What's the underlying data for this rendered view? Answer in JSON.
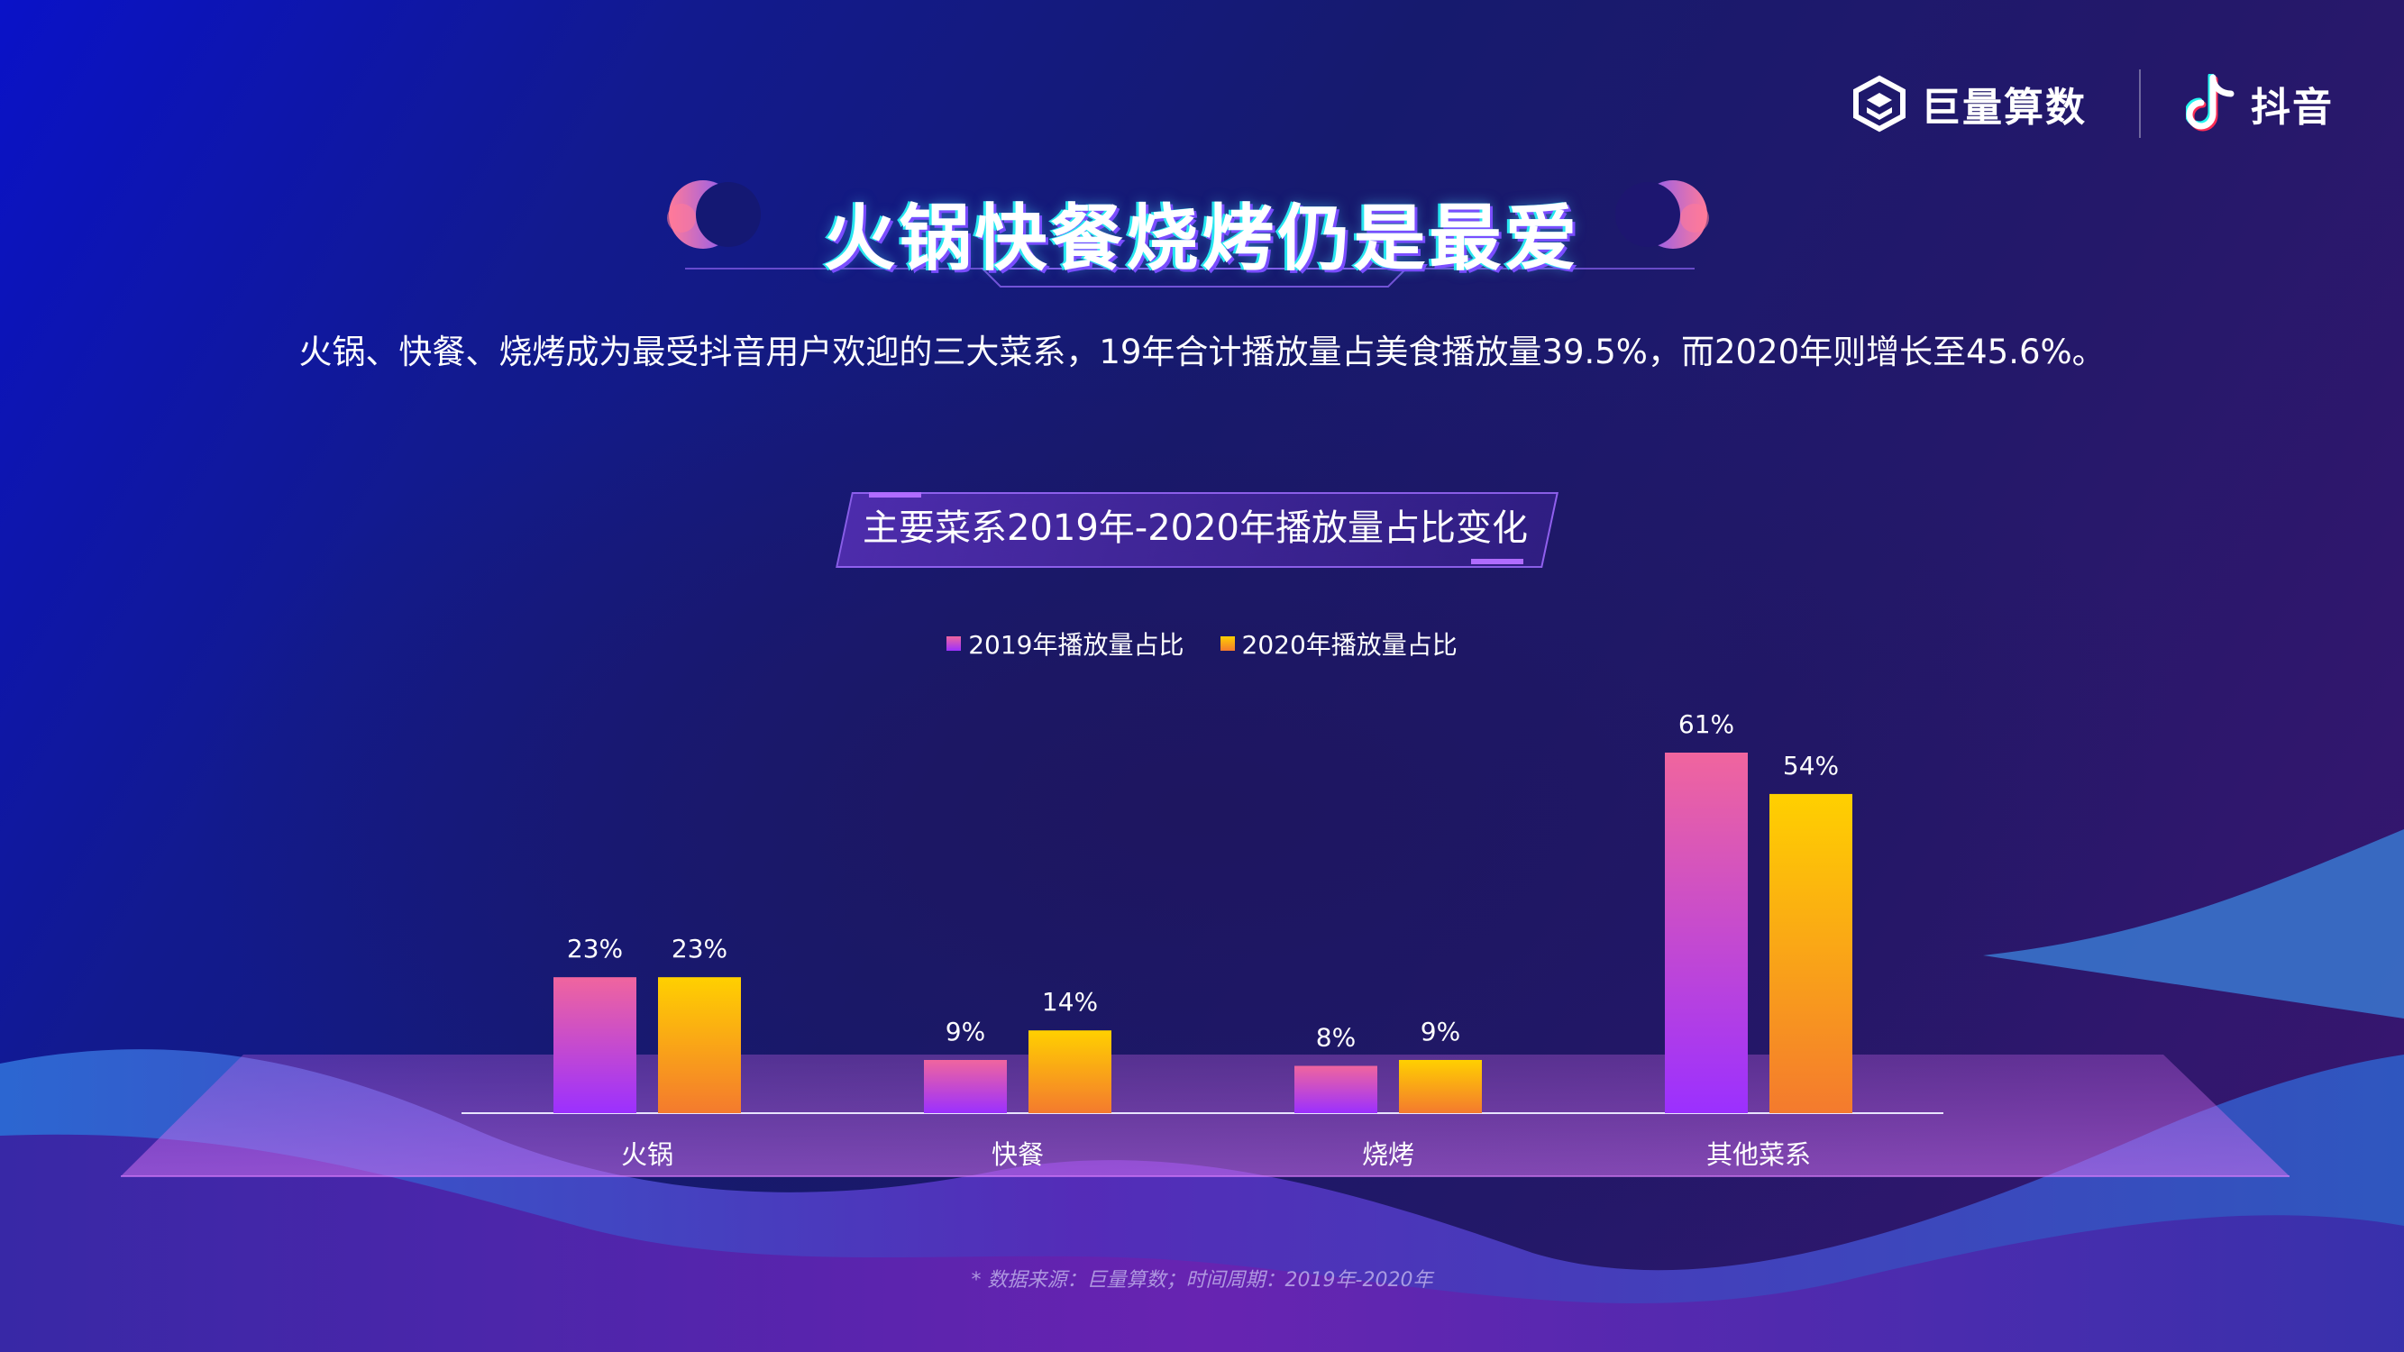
{
  "brand": {
    "ocean_engine_label": "巨量算数",
    "ocean_engine_icon": "ocean-engine-logo-icon",
    "douyin_label": "抖音",
    "douyin_icon": "douyin-logo-icon"
  },
  "header": {
    "title": "火锅快餐烧烤仍是最爱",
    "subtitle": "火锅、快餐、烧烤成为最受抖音用户欢迎的三大菜系，19年合计播放量占美食播放量39.5%，而2020年则增长至45.6%。"
  },
  "chart_data": {
    "type": "bar",
    "title": "主要菜系2019年-2020年播放量占比变化",
    "categories": [
      "火锅",
      "快餐",
      "烧烤",
      "其他菜系"
    ],
    "series": [
      {
        "name": "2019年播放量占比",
        "values": [
          23,
          9,
          8,
          61
        ],
        "labels": [
          "23%",
          "9%",
          "8%",
          "61%"
        ],
        "color_top": "#f0659e",
        "color_bottom": "#9b30ff"
      },
      {
        "name": "2020年播放量占比",
        "values": [
          23,
          14,
          9,
          54
        ],
        "labels": [
          "23%",
          "14%",
          "9%",
          "54%"
        ],
        "color_top": "#ffd000",
        "color_bottom": "#f47a2e"
      }
    ],
    "unit": "%",
    "ylim": [
      0,
      61
    ],
    "grid": false,
    "legend_position": "top-center"
  },
  "footnote": "* 数据来源：巨量算数；时间周期：2019年-2020年"
}
